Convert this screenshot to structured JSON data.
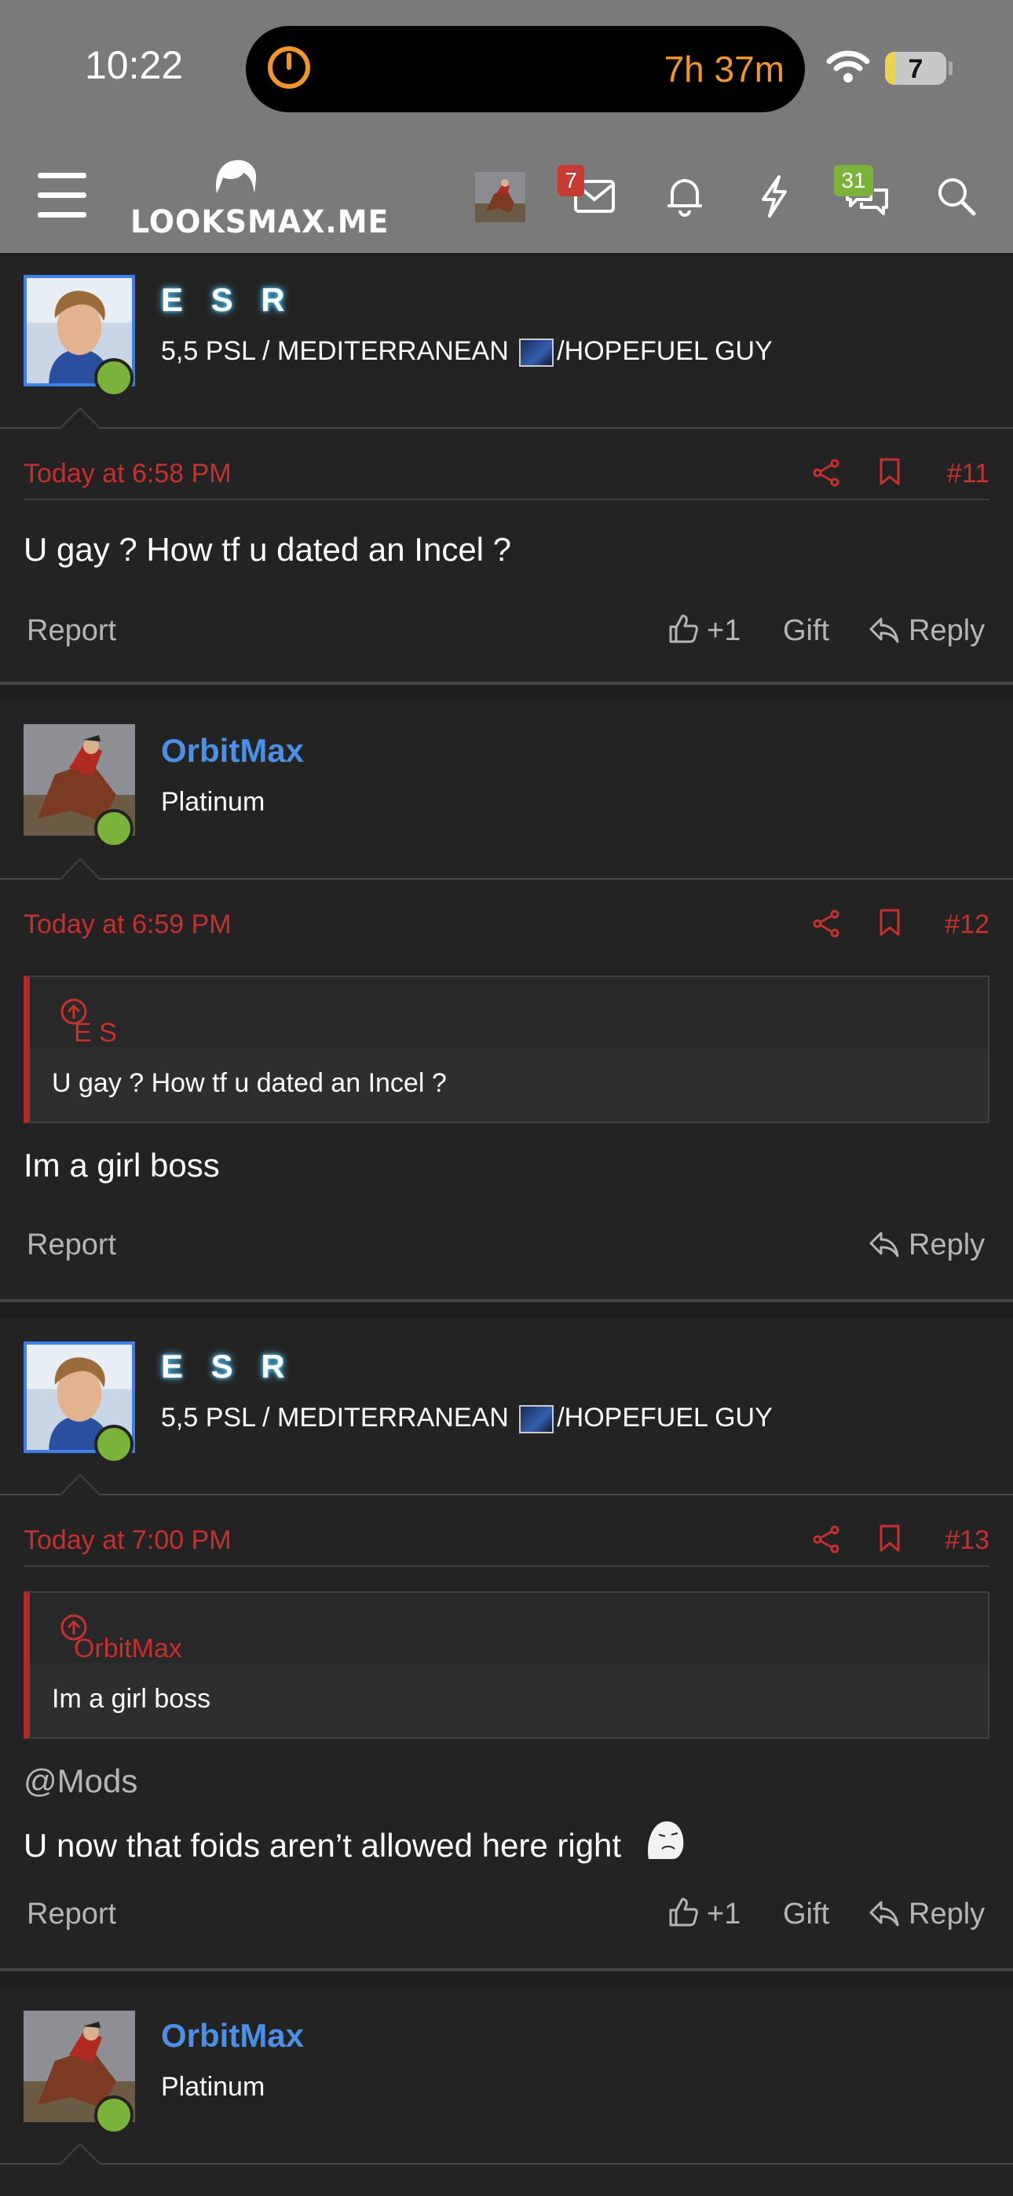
{
  "status": {
    "time": "10:22",
    "timer": "7h 37m",
    "battery": "7"
  },
  "nav": {
    "logo": "LOOKSMAX.ME",
    "messages_badge": "7",
    "chat_badge": "31"
  },
  "colors": {
    "accent_red": "#c8302d",
    "orbit_blue": "#4b8fe6",
    "online_green": "#7bb23a",
    "background": "#232323",
    "navbar": "#7a7a7a"
  },
  "posts": [
    {
      "author": "E S R",
      "title_before": "5,5 PSL / MEDITERRANEAN ",
      "title_after": "/HOPEFUEL GUY",
      "date": "Today at 6:58 PM",
      "number": "#11",
      "body": "U gay ? How tf u dated an Incel ?",
      "report": "Report",
      "likes": "+1",
      "gift": "Gift",
      "reply": "Reply"
    },
    {
      "author": "OrbitMax",
      "title": "Platinum",
      "date": "Today at 6:59 PM",
      "number": "#12",
      "quote_author": "E S R said:",
      "quote_text": "U gay ? How tf u dated an Incel ?",
      "body": "Im a girl boss",
      "report": "Report",
      "reply": "Reply"
    },
    {
      "author": "E S R",
      "title_before": "5,5 PSL / MEDITERRANEAN ",
      "title_after": "/HOPEFUEL GUY",
      "date": "Today at 7:00 PM",
      "number": "#13",
      "quote_author": "OrbitMax said:",
      "quote_text": "Im a girl boss",
      "mention": "@Mods",
      "body": "U now that foids aren’t allowed here right",
      "report": "Report",
      "likes": "+1",
      "gift": "Gift",
      "reply": "Reply"
    },
    {
      "author": "OrbitMax",
      "title": "Platinum"
    }
  ]
}
